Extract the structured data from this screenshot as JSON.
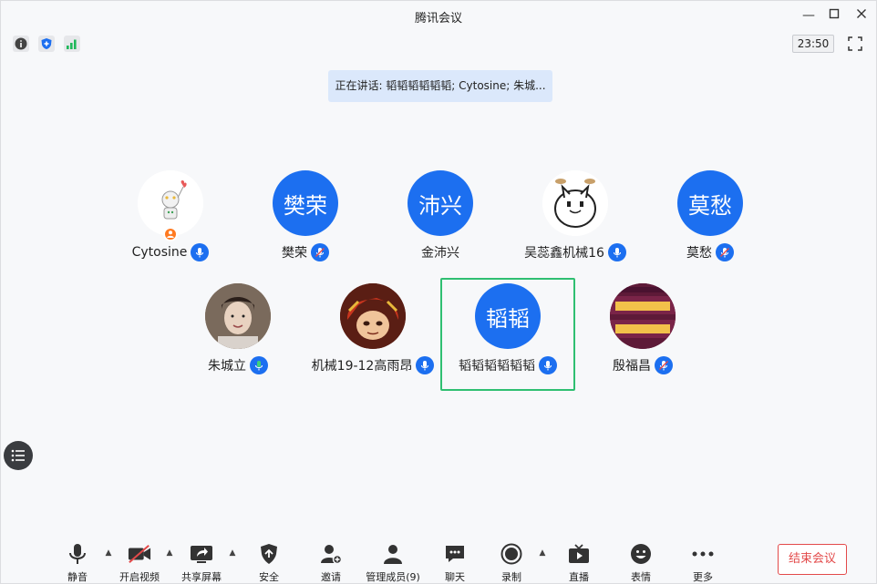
{
  "window": {
    "title": "腾讯会议",
    "minimize": "—",
    "maximize": "☐",
    "close": "✕"
  },
  "topbar": {
    "clock": "23:50"
  },
  "speaking": {
    "text": "正在讲话: 韬韬韬韬韬韬; Cytosine; 朱城..."
  },
  "participants": [
    {
      "name": "Cytosine",
      "avatar_text": ""
    },
    {
      "name": "樊荣",
      "avatar_text": "樊荣"
    },
    {
      "name": "金沛兴",
      "avatar_text": "沛兴"
    },
    {
      "name": "吴蕊鑫机械16",
      "avatar_text": ""
    },
    {
      "name": "莫愁",
      "avatar_text": "莫愁"
    },
    {
      "name": "朱城立",
      "avatar_text": ""
    },
    {
      "name": "机械19-12高雨昂",
      "avatar_text": ""
    },
    {
      "name": "韬韬韬韬韬韬",
      "avatar_text": "韬韬"
    },
    {
      "name": "殷福昌",
      "avatar_text": ""
    }
  ],
  "toolbar": {
    "mute": "静音",
    "video": "开启视频",
    "share": "共享屏幕",
    "security": "安全",
    "invite": "邀请",
    "members": "管理成员(9)",
    "chat": "聊天",
    "record": "录制",
    "live": "直播",
    "emoji": "表情",
    "more": "更多",
    "end": "结束会议"
  },
  "colors": {
    "accent": "#1c6ff0",
    "active_border": "#2fbf71",
    "end": "#e34a4a",
    "host": "#ff7a21"
  }
}
